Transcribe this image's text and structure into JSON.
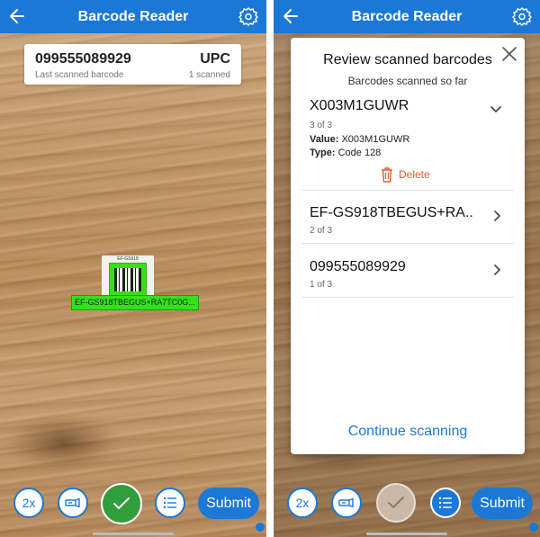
{
  "app": {
    "title": "Barcode Reader"
  },
  "left_screen": {
    "last_scanned": {
      "value": "099555089929",
      "caption": "Last scanned barcode",
      "type": "UPC",
      "count": "1 scanned"
    },
    "sticker_text": "EF-GS918",
    "overlay_label": "EF-GS918TBEGUS+RA7TC0G..."
  },
  "controls": {
    "zoom_label": "2x",
    "submit_label": "Submit"
  },
  "review": {
    "title": "Review scanned barcodes",
    "subtitle": "Barcodes scanned so far",
    "items": [
      {
        "code": "X003M1GUWR",
        "count": "3 of 3",
        "value_label": "Value:",
        "value": "X003M1GUWR",
        "type_label": "Type:",
        "type": "Code 128",
        "delete_label": "Delete",
        "expanded": true
      },
      {
        "code": "EF-GS918TBEGUS+RA..",
        "count": "2 of 3",
        "expanded": false
      },
      {
        "code": "099555089929",
        "count": "1 of 3",
        "expanded": false
      }
    ],
    "continue_label": "Continue scanning"
  },
  "colors": {
    "primary": "#1b78d6",
    "confirm_green": "#2f9e3b",
    "highlight_green": "#33e01c",
    "delete_orange": "#e05a2b"
  },
  "icons": [
    "back-arrow-icon",
    "settings-icon",
    "flashlight-icon",
    "checkmark-icon",
    "list-icon",
    "close-icon",
    "chevron-down-icon",
    "chevron-right-icon",
    "trash-icon"
  ]
}
